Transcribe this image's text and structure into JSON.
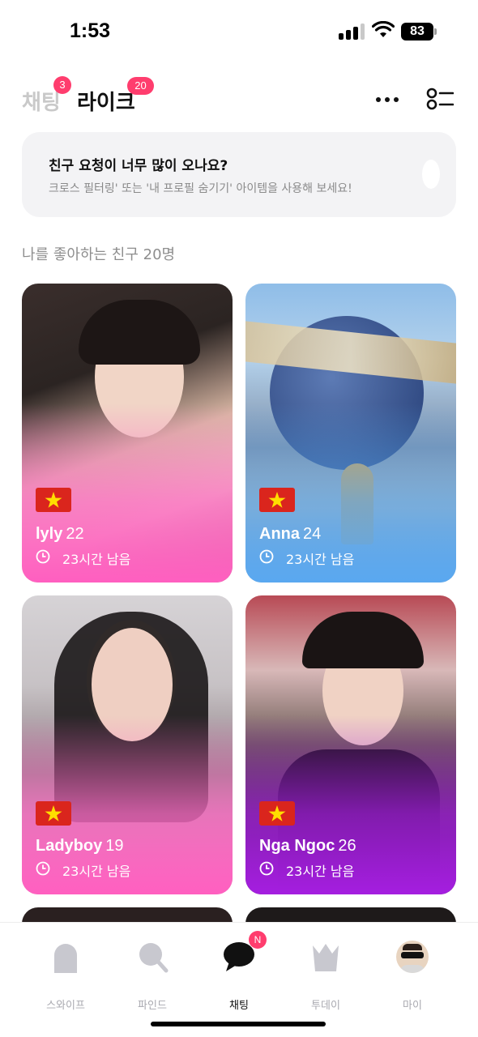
{
  "status_bar": {
    "time": "1:53",
    "battery": "83"
  },
  "header": {
    "tabs": [
      {
        "label": "채팅",
        "badge": "3",
        "active": false
      },
      {
        "label": "라이크",
        "badge": "20",
        "active": true
      }
    ],
    "more_icon": "more-horizontal-icon",
    "filter_icon": "filter-list-icon"
  },
  "banner": {
    "title": "친구 요청이 너무 많이 오나요?",
    "description": "크로스 필터링' 또는 '내 프로필 숨기기' 아이템을 사용해 보세요!"
  },
  "section_label": "나를 좋아하는 친구 20명",
  "cards": [
    {
      "name": "lyly",
      "age": "22",
      "timer": "23시간 남음",
      "flag": "vietnam-flag",
      "accent": "#ff5fc0"
    },
    {
      "name": "Anna",
      "age": "24",
      "timer": "23시간 남음",
      "flag": "vietnam-flag",
      "accent": "#5aa8f0"
    },
    {
      "name": "Ladyboy",
      "age": "19",
      "timer": "23시간 남음",
      "flag": "vietnam-flag",
      "accent": "#ff5fc0"
    },
    {
      "name": "Nga Ngoc",
      "age": "26",
      "timer": "23시간 남음",
      "flag": "vietnam-flag",
      "accent": "#a51ee0"
    }
  ],
  "bottom_nav": {
    "items": [
      {
        "label": "스와이프",
        "icon": "swipe-card-icon",
        "active": false
      },
      {
        "label": "파인드",
        "icon": "search-icon",
        "active": false
      },
      {
        "label": "채팅",
        "icon": "chat-bubble-icon",
        "active": true,
        "badge": "N"
      },
      {
        "label": "투데이",
        "icon": "crown-icon",
        "active": false
      },
      {
        "label": "마이",
        "icon": "avatar-icon",
        "active": false
      }
    ]
  },
  "colors": {
    "badge": "#ff3d6e",
    "muted": "#8e8e8e",
    "inactive_nav": "#a9a9b0"
  }
}
